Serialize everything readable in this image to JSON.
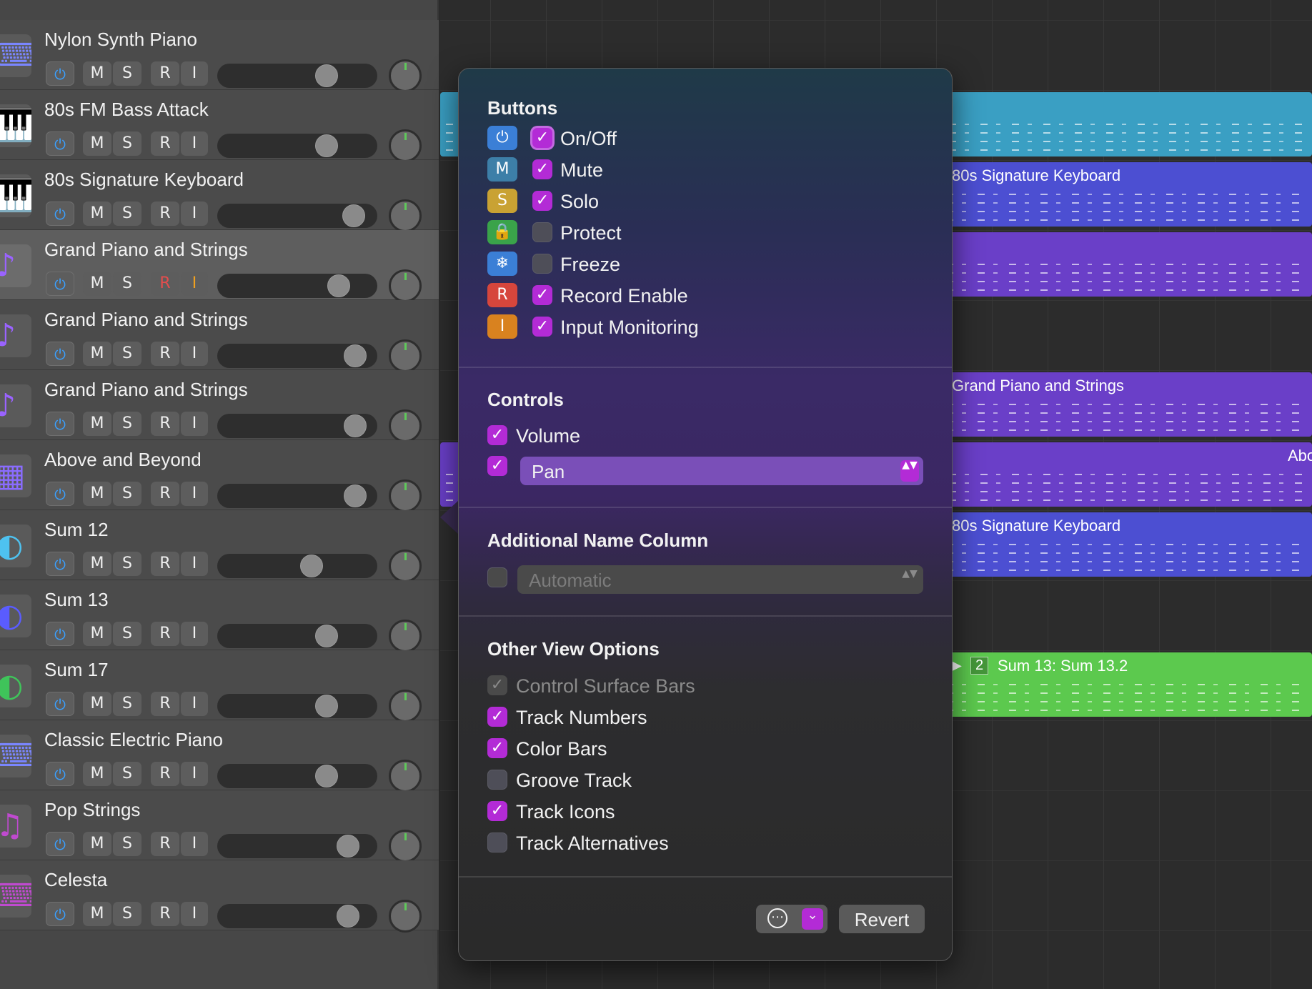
{
  "tracks": [
    {
      "name": "Nylon Synth Piano",
      "icon": "keyboard-stand-icon",
      "glyph": "⌨",
      "color": "#7a86ff"
    },
    {
      "name": "80s FM Bass Attack",
      "icon": "synth-keyboard-icon",
      "glyph": "🎹",
      "color": "#37a6d8"
    },
    {
      "name": "80s Signature Keyboard",
      "icon": "synth-keyboard-icon",
      "glyph": "🎹",
      "color": "#6b6cff"
    },
    {
      "name": "Grand Piano and Strings",
      "icon": "grand-piano-icon",
      "glyph": "♪",
      "color": "#9a63ff"
    },
    {
      "name": "Grand Piano and Strings",
      "icon": "grand-piano-icon",
      "glyph": "♪",
      "color": "#9a63ff"
    },
    {
      "name": "Grand Piano and Strings",
      "icon": "grand-piano-icon",
      "glyph": "♪",
      "color": "#9a63ff"
    },
    {
      "name": "Above and Beyond",
      "icon": "synth-module-icon",
      "glyph": "▦",
      "color": "#8a6cff"
    },
    {
      "name": "Sum 12",
      "icon": "summing-stack-icon",
      "glyph": "◐",
      "color": "#4ec2f0"
    },
    {
      "name": "Sum 13",
      "icon": "summing-stack-icon",
      "glyph": "◐",
      "color": "#5a5cff"
    },
    {
      "name": "Sum 17",
      "icon": "summing-stack-icon",
      "glyph": "◐",
      "color": "#3fc45a"
    },
    {
      "name": "Classic Electric Piano",
      "icon": "electric-piano-icon",
      "glyph": "⌨",
      "color": "#7a86ff"
    },
    {
      "name": "Pop Strings",
      "icon": "violin-icon",
      "glyph": "♫",
      "color": "#c04ad0"
    },
    {
      "name": "Celesta",
      "icon": "celesta-icon",
      "glyph": "⌨",
      "color": "#c04ad0"
    }
  ],
  "track_buttons": {
    "power": "⏻",
    "mute": "M",
    "solo": "S",
    "record": "R",
    "input": "I"
  },
  "volume_levels": [
    0.72,
    0.72,
    0.92,
    0.81,
    0.93,
    0.93,
    0.93,
    0.61,
    0.72,
    0.72,
    0.72,
    0.88,
    0.88
  ],
  "regions": [
    {
      "name": "",
      "color": "#3a9fc3"
    },
    {
      "name": "80s Signature Keyboard",
      "color": "#4c4fd2"
    },
    {
      "name": "",
      "color": "#6a3fc8"
    },
    {
      "name": "Grand Piano and Strings",
      "color": "#6a3fc8"
    },
    {
      "name": "",
      "color": "#6a3fc8"
    },
    {
      "name": "Abo",
      "color": "#6a3fc8"
    },
    {
      "name": "80s Signature Keyboard",
      "color": "#4c4fd2"
    },
    {
      "name": "Sum 13: Sum 13.2",
      "number": "2",
      "color": "#5cc94e"
    }
  ],
  "popover": {
    "buttons_title": "Buttons",
    "buttons": [
      {
        "label": "On/Off",
        "icon": "power-icon",
        "glyph": "⏻",
        "icon_color": "#3b7fd6",
        "checked": true
      },
      {
        "label": "Mute",
        "icon": "mute-icon",
        "glyph": "M",
        "icon_color": "#3d7fa8",
        "checked": true
      },
      {
        "label": "Solo",
        "icon": "solo-icon",
        "glyph": "S",
        "icon_color": "#c9a233",
        "checked": true
      },
      {
        "label": "Protect",
        "icon": "lock-icon",
        "glyph": "🔒",
        "icon_color": "#3aa34a",
        "checked": false
      },
      {
        "label": "Freeze",
        "icon": "snowflake-icon",
        "glyph": "❄",
        "icon_color": "#3b7fd6",
        "checked": false
      },
      {
        "label": "Record Enable",
        "icon": "record-icon",
        "glyph": "R",
        "icon_color": "#d6463c",
        "checked": true
      },
      {
        "label": "Input Monitoring",
        "icon": "input-monitoring-icon",
        "glyph": "I",
        "icon_color": "#d9821f",
        "checked": true
      }
    ],
    "controls_title": "Controls",
    "volume_label": "Volume",
    "pan_value": "Pan",
    "name_column_title": "Additional Name Column",
    "name_column_value": "Automatic",
    "other_title": "Other View Options",
    "options": [
      {
        "label": "Control Surface Bars",
        "checked": true,
        "disabled": true
      },
      {
        "label": "Track Numbers",
        "checked": true,
        "disabled": false
      },
      {
        "label": "Color Bars",
        "checked": true,
        "disabled": false
      },
      {
        "label": "Groove Track",
        "checked": false,
        "disabled": false
      },
      {
        "label": "Track Icons",
        "checked": true,
        "disabled": false
      },
      {
        "label": "Track Alternatives",
        "checked": false,
        "disabled": false
      }
    ],
    "more_glyph": "⋯",
    "chevron_glyph": "⌄",
    "revert_label": "Revert"
  },
  "check_glyph": "✓",
  "popup_arrows": "▲▼",
  "colors": {
    "accent": "#b32bd6",
    "focus": "#c36ae0",
    "power_blue": "#3aa0ff",
    "meter_green": "#5fc85a"
  }
}
